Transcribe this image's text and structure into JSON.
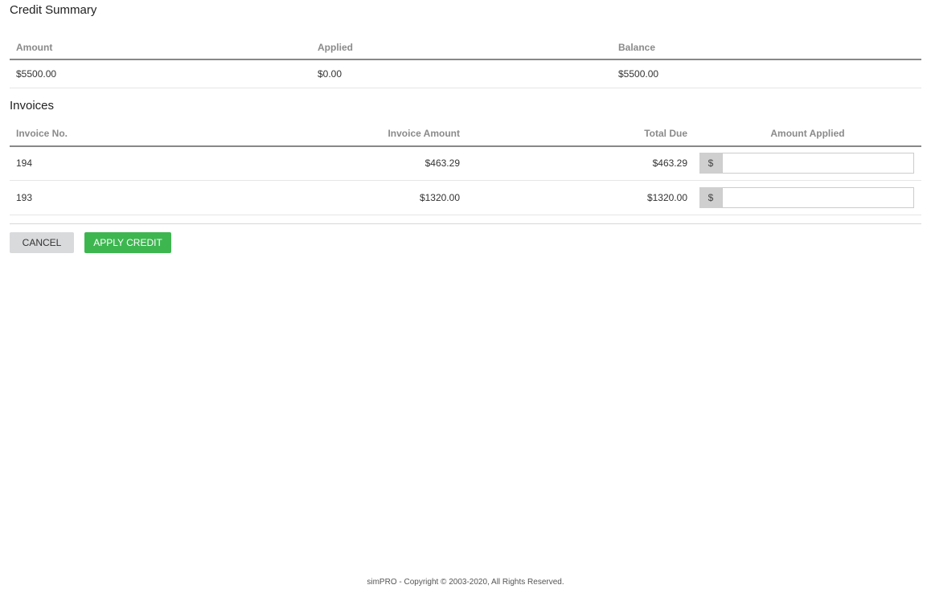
{
  "credit_summary": {
    "title": "Credit Summary",
    "columns": [
      "Amount",
      "Applied",
      "Balance"
    ],
    "row": {
      "amount": "$5500.00",
      "applied": "$0.00",
      "balance": "$5500.00"
    }
  },
  "invoices": {
    "title": "Invoices",
    "columns": [
      "Invoice No.",
      "Invoice Amount",
      "Total Due",
      "Amount Applied"
    ],
    "currency_symbol": "$",
    "rows": [
      {
        "invoice_no": "194",
        "invoice_amount": "$463.29",
        "total_due": "$463.29",
        "amount_applied": ""
      },
      {
        "invoice_no": "193",
        "invoice_amount": "$1320.00",
        "total_due": "$1320.00",
        "amount_applied": ""
      }
    ]
  },
  "actions": {
    "cancel_label": "CANCEL",
    "apply_label": "APPLY CREDIT"
  },
  "footer": {
    "text": "simPRO - Copyright © 2003-2020, All Rights Reserved."
  },
  "colors": {
    "apply_button": "#3db650",
    "cancel_button": "#d9dadc",
    "header_text": "#8a8a8a"
  }
}
